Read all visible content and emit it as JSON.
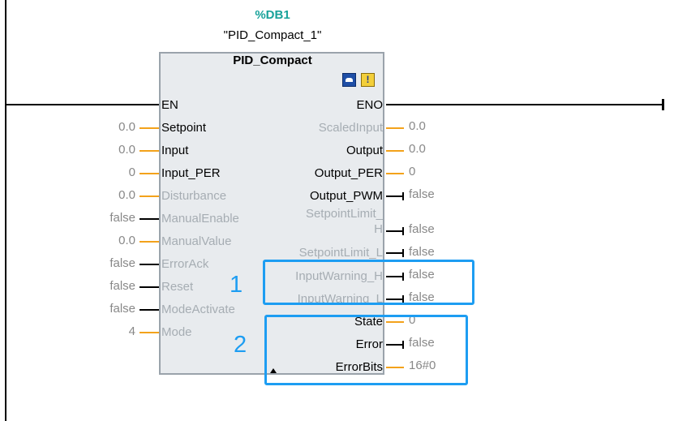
{
  "instance": {
    "db_number": "%DB1",
    "name": "\"PID_Compact_1\""
  },
  "block": {
    "type": "PID_Compact",
    "icons": [
      "display-icon",
      "warning-icon"
    ]
  },
  "inputs": [
    {
      "label": "EN",
      "value": ""
    },
    {
      "label": "Setpoint",
      "value": "0.0"
    },
    {
      "label": "Input",
      "value": "0.0"
    },
    {
      "label": "Input_PER",
      "value": "0"
    },
    {
      "label": "Disturbance",
      "value": "0.0"
    },
    {
      "label": "ManualEnable",
      "value": "false"
    },
    {
      "label": "ManualValue",
      "value": "0.0"
    },
    {
      "label": "ErrorAck",
      "value": "false"
    },
    {
      "label": "Reset",
      "value": "false"
    },
    {
      "label": "ModeActivate",
      "value": "false"
    },
    {
      "label": "Mode",
      "value": "4"
    }
  ],
  "outputs": [
    {
      "label": "ENO",
      "value": ""
    },
    {
      "label": "ScaledInput",
      "value": "0.0"
    },
    {
      "label": "Output",
      "value": "0.0"
    },
    {
      "label": "Output_PER",
      "value": "0"
    },
    {
      "label": "Output_PWM",
      "value": "false"
    },
    {
      "label": "SetpointLimit_",
      "label2": "H",
      "value": "false"
    },
    {
      "label": "SetpointLimit_L",
      "value": "false"
    },
    {
      "label": "InputWarning_H",
      "value": "false"
    },
    {
      "label": "InputWarning_L",
      "value": "false"
    },
    {
      "label": "State",
      "value": "0"
    },
    {
      "label": "Error",
      "value": "false"
    },
    {
      "label": "ErrorBits",
      "value": "16#0"
    }
  ],
  "callouts": [
    "1",
    "2"
  ],
  "colors": {
    "wire_numeric": "#f3a21b",
    "wire_bool": "#000000",
    "callout": "#1d9df2",
    "db_label": "#18a29a",
    "inactive_pin": "#a6adb3"
  }
}
